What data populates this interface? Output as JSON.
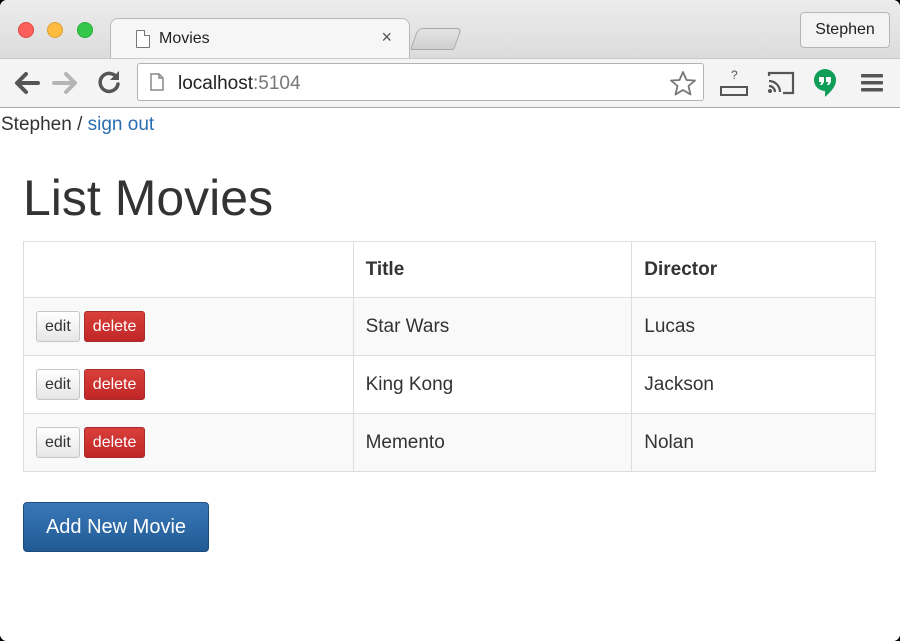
{
  "browser": {
    "tab_title": "Movies",
    "tab_close": "×",
    "profile_name": "Stephen",
    "url_host": "localhost",
    "url_port": ":5104",
    "back_icon": "arrow-left-icon",
    "forward_icon": "arrow-right-icon",
    "reload_icon": "reload-icon"
  },
  "header": {
    "user_name": "Stephen",
    "separator": " / ",
    "sign_out_label": "sign out"
  },
  "page": {
    "title": "List Movies"
  },
  "table": {
    "columns": [
      "",
      "Title",
      "Director"
    ],
    "rows": [
      {
        "title": "Star Wars",
        "director": "Lucas"
      },
      {
        "title": "King Kong",
        "director": "Jackson"
      },
      {
        "title": "Memento",
        "director": "Nolan"
      }
    ],
    "edit_label": "edit",
    "delete_label": "delete"
  },
  "actions": {
    "add_label": "Add New Movie"
  },
  "colors": {
    "link": "#2a6db0",
    "delete": "#c9302c",
    "primary": "#286090"
  }
}
